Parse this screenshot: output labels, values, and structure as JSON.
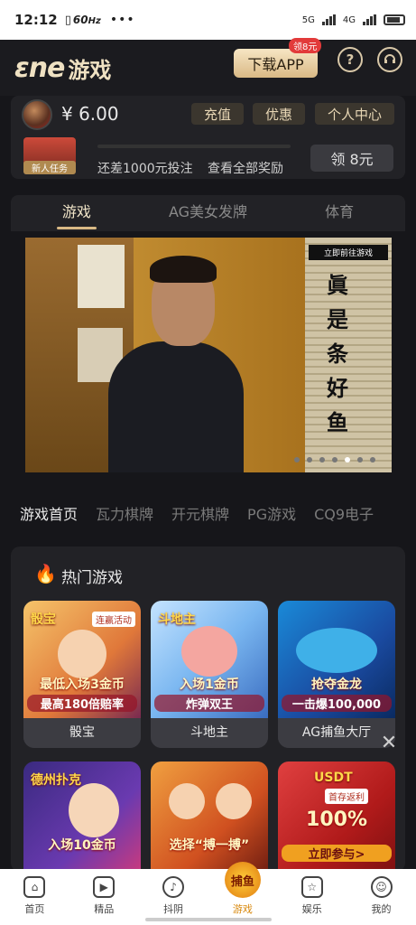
{
  "status_bar": {
    "time": "12:12",
    "refresh": "60",
    "refresh_unit": "Hz",
    "more": "•••",
    "sim1": "5G",
    "sim2": "4G"
  },
  "header": {
    "logo": "ɛne",
    "logo_cn": "游戏",
    "download_label": "下载APP",
    "download_badge": "领8元",
    "help_icon": "?",
    "support_icon": "headset-icon"
  },
  "account": {
    "balance": "¥ 6.00",
    "buttons": [
      "充值",
      "优惠",
      "个人中心"
    ],
    "mission_label": "新人任务",
    "mission_progress": 0.0,
    "mission_text": "还差1000元投注",
    "mission_link": "查看全部奖励",
    "claim_label": "领 8元"
  },
  "tabs": [
    "游戏",
    "AG美女发牌",
    "体育"
  ],
  "banner": {
    "tag": "立即前往游戏",
    "vertical_text": [
      "眞",
      "是",
      "条",
      "好",
      "鱼"
    ],
    "slide_count": 7,
    "active_slide": 5
  },
  "categories": [
    "游戏首页",
    "瓦力棋牌",
    "开元棋牌",
    "PG游戏",
    "CQ9电子"
  ],
  "hot": {
    "title": "热门游戏",
    "games": [
      {
        "name": "骰宝",
        "logo": "骰宝",
        "corner": "连赢活动",
        "cap1": "最低入场3金币",
        "cap2": "最高180倍赔率"
      },
      {
        "name": "斗地主",
        "logo": "斗地主",
        "corner": "",
        "cap1": "入场1金币",
        "cap2": "炸弹双王"
      },
      {
        "name": "AG捕鱼大厅",
        "logo": "",
        "corner": "",
        "cap1": "抢夺金龙",
        "cap2": "一击爆100,000"
      },
      {
        "name": "",
        "logo": "德州扑克",
        "corner": "",
        "cap1": "入场10金币",
        "cap2": ""
      },
      {
        "name": "",
        "logo": "",
        "corner": "",
        "cap1": "选择“搏一搏”",
        "cap2": ""
      },
      {
        "name": "",
        "logo": "USDT",
        "corner": "首存返利",
        "cap1": "100%",
        "cap2": "立即参与>"
      }
    ]
  },
  "bottom_nav": [
    "首页",
    "精品",
    "抖阴",
    "游戏",
    "娱乐",
    "我的"
  ],
  "bottom_nav_center_badge": "捕鱼",
  "colors": {
    "accent": "#d9b985",
    "background": "#16161a",
    "panel": "#222226"
  }
}
